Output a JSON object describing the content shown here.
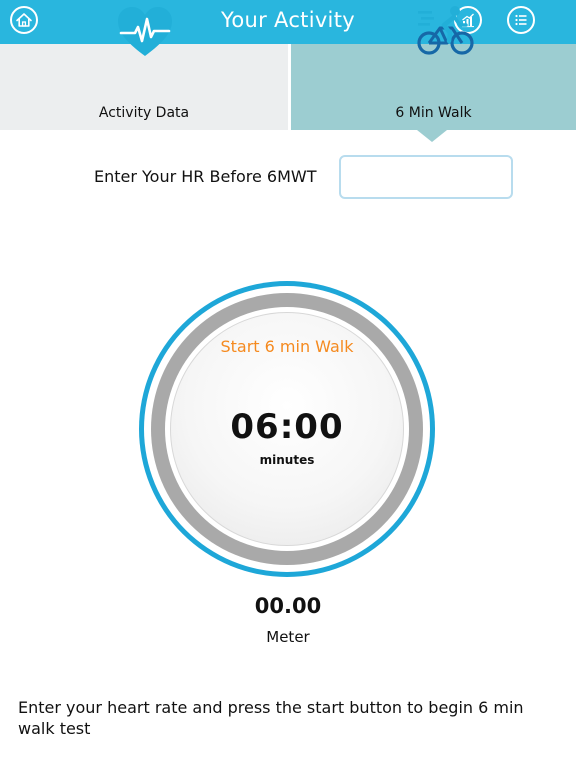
{
  "header": {
    "title": "Your Activity",
    "accent_color": "#29b6de",
    "home_icon": "home-icon",
    "chart_icon": "chart-icon",
    "menu_icon": "list-menu-icon"
  },
  "tabs": [
    {
      "label": "Activity Data",
      "icon": "heart-pulse-icon",
      "selected": false
    },
    {
      "label": "6 Min Walk",
      "icon": "cycling-icon",
      "selected": true
    }
  ],
  "form": {
    "hr_label": "Enter Your HR Before 6MWT",
    "hr_value": "",
    "hr_placeholder": ""
  },
  "dial": {
    "start_label": "Start 6 min Walk",
    "start_color": "#f58a1f",
    "timer": "06:00",
    "timer_unit": "minutes"
  },
  "distance": {
    "value": "00.00",
    "unit": "Meter"
  },
  "instructions": "Enter your heart rate and press the start button to begin 6 min walk test"
}
